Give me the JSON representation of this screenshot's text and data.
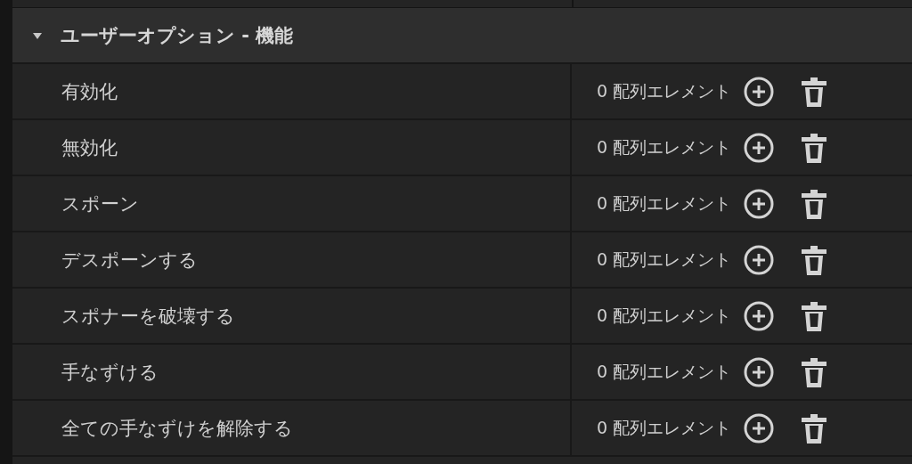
{
  "section": {
    "title": "ユーザーオプション - 機能",
    "expanded": true,
    "rows": [
      {
        "label": "有効化",
        "value": "0 配列エレメント"
      },
      {
        "label": "無効化",
        "value": "0 配列エレメント"
      },
      {
        "label": "スポーン",
        "value": "0 配列エレメント"
      },
      {
        "label": "デスポーンする",
        "value": "0 配列エレメント"
      },
      {
        "label": "スポナーを破壊する",
        "value": "0 配列エレメント"
      },
      {
        "label": "手なずける",
        "value": "0 配列エレメント"
      },
      {
        "label": "全ての手なずけを解除する",
        "value": "0 配列エレメント"
      }
    ]
  }
}
